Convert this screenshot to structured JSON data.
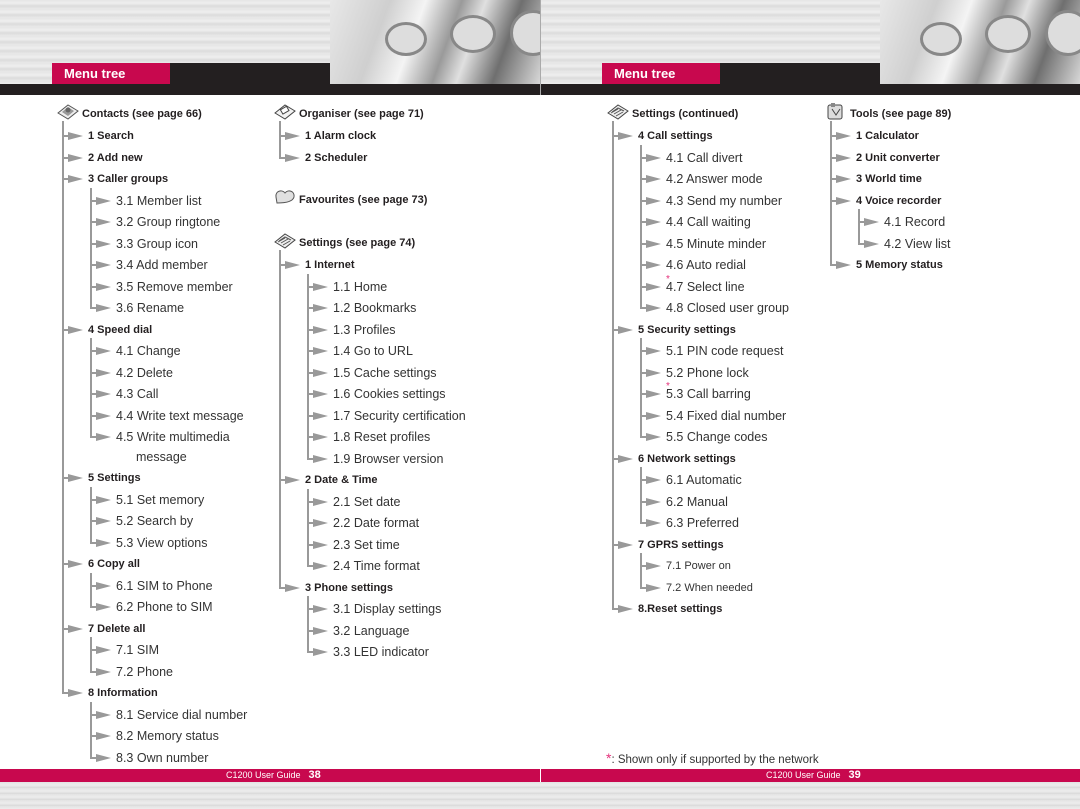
{
  "pages": [
    {
      "header": {
        "title": "Menu tree"
      },
      "footer": {
        "guide": "C1200 User Guide",
        "page": "38"
      }
    },
    {
      "header": {
        "title": "Menu tree"
      },
      "footer": {
        "guide": "C1200 User Guide",
        "page": "39"
      }
    }
  ],
  "icons": {
    "contacts": "address-book-icon",
    "organiser": "calendar-book-icon",
    "favourites": "heart-icon",
    "settings": "settings-keyboard-icon",
    "tools": "toolbox-icon"
  },
  "columns": [
    {
      "heading": "Contacts (see page 66)",
      "items": [
        {
          "label": "1 Search"
        },
        {
          "label": "2 Add new"
        },
        {
          "label": "3 Caller groups",
          "children": [
            "3.1 Member list",
            "3.2 Group ringtone",
            "3.3 Group icon",
            "3.4 Add member",
            "3.5 Remove member",
            "3.6 Rename"
          ]
        },
        {
          "label": "4 Speed dial",
          "children": [
            "4.1 Change",
            "4.2 Delete",
            "4.3 Call",
            "4.4 Write text message",
            "4.5 Write multimedia message"
          ]
        },
        {
          "label": "5 Settings",
          "children": [
            "5.1 Set memory",
            "5.2 Search by",
            "5.3 View options"
          ]
        },
        {
          "label": "6 Copy all",
          "children": [
            "6.1 SIM to Phone",
            "6.2 Phone to SIM"
          ]
        },
        {
          "label": "7 Delete all",
          "children": [
            "7.1 SIM",
            "7.2 Phone"
          ]
        },
        {
          "label": "8 Information",
          "children": [
            "8.1 Service dial number",
            "8.2 Memory status",
            "8.3 Own number"
          ]
        }
      ]
    },
    {
      "groups": [
        {
          "heading": "Organiser (see page 71)",
          "items": [
            {
              "label": "1 Alarm clock"
            },
            {
              "label": "2 Scheduler"
            }
          ]
        },
        {
          "heading": "Favourites (see page 73)",
          "items": []
        },
        {
          "heading": "Settings (see page 74)",
          "items": [
            {
              "label": "1 Internet",
              "children": [
                "1.1 Home",
                "1.2 Bookmarks",
                "1.3 Profiles",
                "1.4 Go to URL",
                "1.5 Cache settings",
                "1.6 Cookies settings",
                "1.7 Security certification",
                "1.8 Reset profiles",
                "1.9 Browser version"
              ]
            },
            {
              "label": "2 Date & Time",
              "children": [
                "2.1 Set date",
                "2.2 Date format",
                "2.3 Set time",
                "2.4 Time format"
              ]
            },
            {
              "label": "3 Phone settings",
              "children": [
                "3.1 Display settings",
                "3.2 Language",
                "3.3 LED indicator"
              ]
            }
          ]
        }
      ]
    },
    {
      "heading": "Settings (continued)",
      "items": [
        {
          "label": "4 Call settings",
          "children": [
            "4.1 Call divert",
            "4.2 Answer mode",
            "4.3 Send my number",
            "4.4 Call waiting",
            "4.5 Minute minder",
            "4.6 Auto redial",
            "4.7 Select line",
            "4.8 Closed user group"
          ],
          "starred": [
            "4.7 Select line"
          ]
        },
        {
          "label": "5 Security settings",
          "children": [
            "5.1 PIN code request",
            "5.2 Phone lock",
            "5.3 Call barring",
            "5.4 Fixed dial number",
            "5.5 Change codes"
          ],
          "starred": [
            "5.3 Call barring"
          ]
        },
        {
          "label": "6 Network settings",
          "children": [
            "6.1 Automatic",
            "6.2 Manual",
            "6.3 Preferred"
          ]
        },
        {
          "label": "7 GPRS settings",
          "children": [
            "7.1 Power on",
            "7.2 When needed"
          ]
        },
        {
          "label": "8.Reset settings"
        }
      ]
    },
    {
      "heading": "Tools (see page 89)",
      "items": [
        {
          "label": "1 Calculator"
        },
        {
          "label": "2 Unit converter"
        },
        {
          "label": "3 World time"
        },
        {
          "label": "4 Voice recorder",
          "children": [
            "4.1 Record",
            "4.2 View list"
          ]
        },
        {
          "label": "5 Memory status"
        }
      ]
    }
  ],
  "note": {
    "symbol": "*",
    "text": ": Shown only if supported by the network"
  },
  "colors": {
    "accent": "#c8084e",
    "dark": "#231f20",
    "star": "#e4307a",
    "tree_line": "#999999"
  }
}
